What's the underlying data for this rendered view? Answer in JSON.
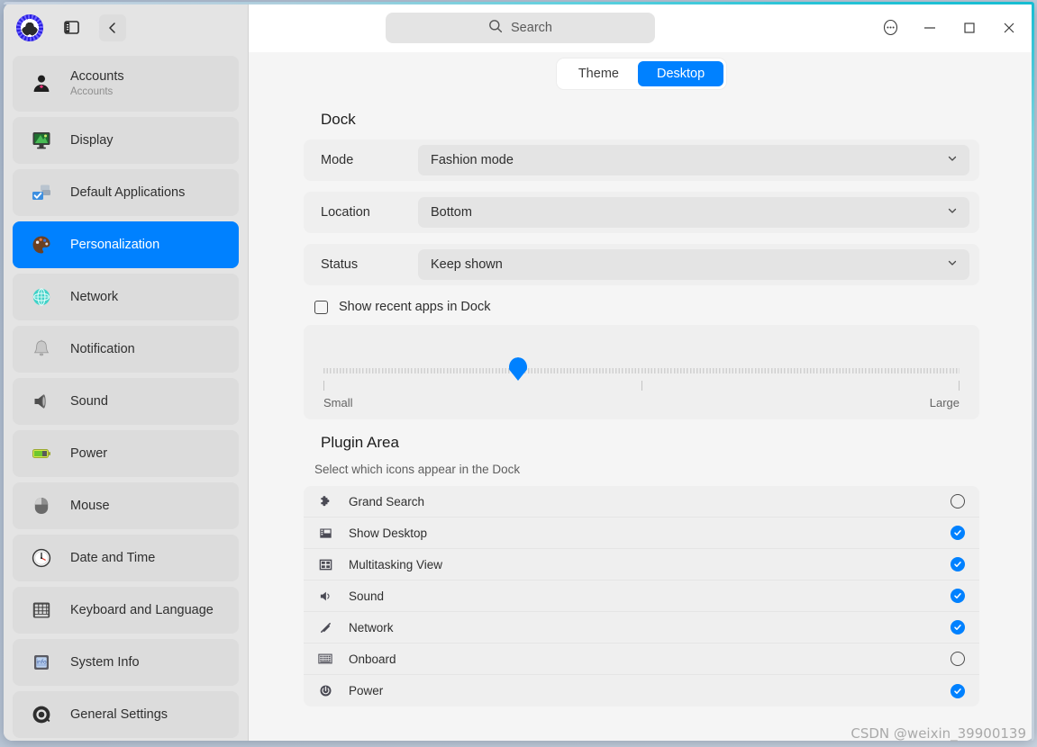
{
  "window": {
    "logo_icon": "deepin-control-center-logo",
    "sidebar_toggle_icon": "sidebar-panel-icon",
    "back_icon": "chevron-left-icon",
    "more_icon": "more-options-icon",
    "minimize_icon": "minimize-icon",
    "maximize_icon": "maximize-icon",
    "close_icon": "close-icon"
  },
  "search": {
    "placeholder": "Search",
    "icon": "search-icon"
  },
  "sidebar": {
    "items": [
      {
        "label": "Accounts",
        "sub": "Accounts",
        "icon": "accounts-icon",
        "active": false
      },
      {
        "label": "Display",
        "sub": "",
        "icon": "display-icon",
        "active": false
      },
      {
        "label": "Default Applications",
        "sub": "",
        "icon": "default-applications-icon",
        "active": false
      },
      {
        "label": "Personalization",
        "sub": "",
        "icon": "personalization-icon",
        "active": true
      },
      {
        "label": "Network",
        "sub": "",
        "icon": "network-icon",
        "active": false
      },
      {
        "label": "Notification",
        "sub": "",
        "icon": "notification-icon",
        "active": false
      },
      {
        "label": "Sound",
        "sub": "",
        "icon": "sound-icon",
        "active": false
      },
      {
        "label": "Power",
        "sub": "",
        "icon": "power-icon",
        "active": false
      },
      {
        "label": "Mouse",
        "sub": "",
        "icon": "mouse-icon",
        "active": false
      },
      {
        "label": "Date and Time",
        "sub": "",
        "icon": "date-and-time-icon",
        "active": false
      },
      {
        "label": "Keyboard and Language",
        "sub": "",
        "icon": "keyboard-icon",
        "active": false
      },
      {
        "label": "System Info",
        "sub": "",
        "icon": "system-info-icon",
        "active": false
      },
      {
        "label": "General Settings",
        "sub": "",
        "icon": "general-settings-icon",
        "active": false
      }
    ]
  },
  "tabs": [
    {
      "label": "Theme",
      "selected": false
    },
    {
      "label": "Desktop",
      "selected": true
    }
  ],
  "dock": {
    "title": "Dock",
    "fields": [
      {
        "label": "Mode",
        "value": "Fashion mode"
      },
      {
        "label": "Location",
        "value": "Bottom"
      },
      {
        "label": "Status",
        "value": "Keep shown"
      }
    ],
    "recent_apps": {
      "label": "Show recent apps in Dock",
      "checked": false
    },
    "size_slider": {
      "min_label": "Small",
      "max_label": "Large",
      "value_percent": 33
    }
  },
  "plugin_area": {
    "title": "Plugin Area",
    "description": "Select which icons appear in the Dock",
    "rows": [
      {
        "label": "Grand Search",
        "icon": "puzzle-piece-icon",
        "enabled": false
      },
      {
        "label": "Show Desktop",
        "icon": "show-desktop-icon",
        "enabled": true
      },
      {
        "label": "Multitasking View",
        "icon": "multitasking-icon",
        "enabled": true
      },
      {
        "label": "Sound",
        "icon": "speaker-icon",
        "enabled": true
      },
      {
        "label": "Network",
        "icon": "network-signal-icon",
        "enabled": true
      },
      {
        "label": "Onboard",
        "icon": "onscreen-keyboard-icon",
        "enabled": false
      },
      {
        "label": "Power",
        "icon": "power-button-icon",
        "enabled": true
      }
    ]
  },
  "watermark": {
    "text": "CSDN @weixin_39900139"
  },
  "colors": {
    "accent": "#0081ff",
    "sidebar_bg": "#e4e4e4",
    "item_bg": "#dcdcdc",
    "main_bg": "#f5f5f5",
    "card_bg": "#efefef"
  }
}
